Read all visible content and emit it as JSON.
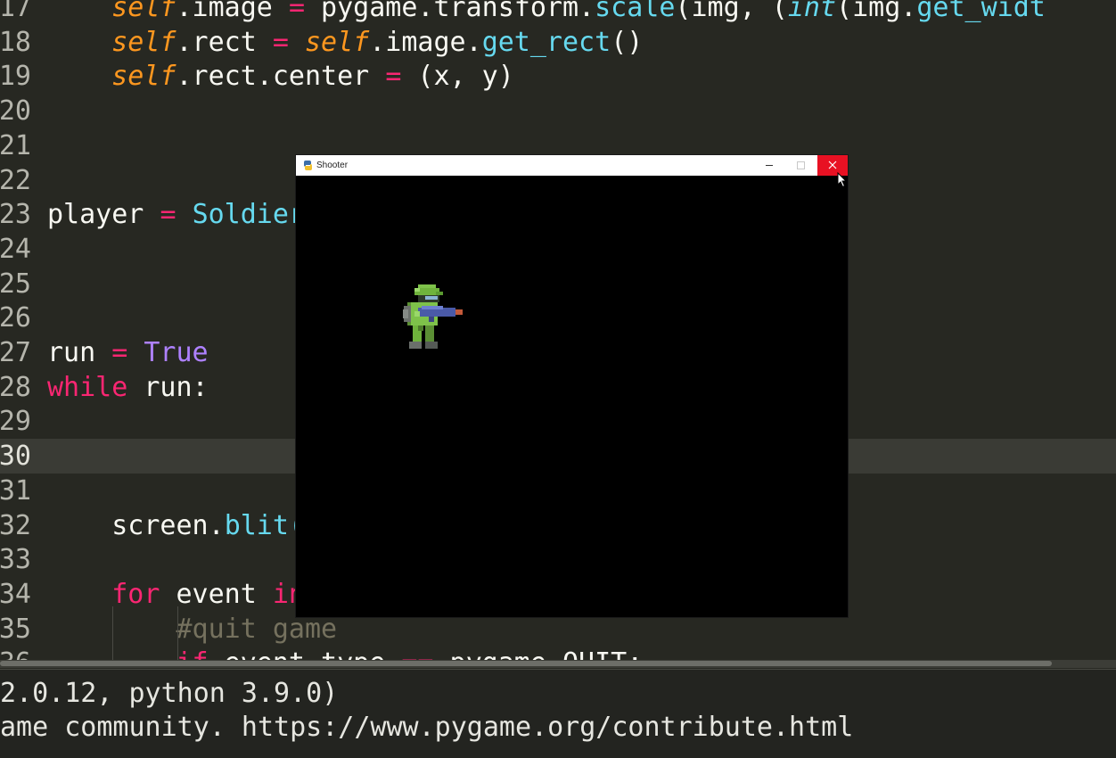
{
  "editor": {
    "lines": [
      {
        "n": "17",
        "tokens": [
          [
            "",
            "    "
          ],
          [
            "self",
            "self"
          ],
          [
            "",
            ".image "
          ],
          [
            "op",
            "="
          ],
          [
            "",
            " pygame.transform."
          ],
          [
            "fn",
            "scale"
          ],
          [
            "",
            "(img, ("
          ],
          [
            "int",
            "int"
          ],
          [
            "",
            "(img."
          ],
          [
            "fn",
            "get_widt"
          ]
        ]
      },
      {
        "n": "18",
        "tokens": [
          [
            "",
            "    "
          ],
          [
            "self",
            "self"
          ],
          [
            "",
            ".rect "
          ],
          [
            "op",
            "="
          ],
          [
            "",
            " "
          ],
          [
            "self",
            "self"
          ],
          [
            "",
            ".image."
          ],
          [
            "fn",
            "get_rect"
          ],
          [
            "",
            "()"
          ]
        ]
      },
      {
        "n": "19",
        "tokens": [
          [
            "",
            "    "
          ],
          [
            "self",
            "self"
          ],
          [
            "",
            ".rect.center "
          ],
          [
            "op",
            "="
          ],
          [
            "",
            " (x, y)"
          ]
        ]
      },
      {
        "n": "20",
        "tokens": []
      },
      {
        "n": "21",
        "tokens": []
      },
      {
        "n": "22",
        "tokens": []
      },
      {
        "n": "23",
        "tokens": [
          [
            "",
            "player "
          ],
          [
            "op",
            "="
          ],
          [
            "",
            " "
          ],
          [
            "fn",
            "Soldier"
          ]
        ]
      },
      {
        "n": "24",
        "tokens": []
      },
      {
        "n": "25",
        "tokens": []
      },
      {
        "n": "26",
        "tokens": []
      },
      {
        "n": "27",
        "tokens": [
          [
            "",
            "run "
          ],
          [
            "op",
            "="
          ],
          [
            "",
            " "
          ],
          [
            "const",
            "True"
          ]
        ]
      },
      {
        "n": "28",
        "tokens": [
          [
            "kw",
            "while"
          ],
          [
            "",
            " run:"
          ]
        ]
      },
      {
        "n": "29",
        "tokens": []
      },
      {
        "n": "30",
        "tokens": [],
        "current": true
      },
      {
        "n": "31",
        "tokens": []
      },
      {
        "n": "32",
        "tokens": [
          [
            "",
            "    screen."
          ],
          [
            "fn",
            "blit("
          ]
        ]
      },
      {
        "n": "33",
        "tokens": []
      },
      {
        "n": "34",
        "tokens": [
          [
            "",
            "    "
          ],
          [
            "kw",
            "for"
          ],
          [
            "",
            " event "
          ],
          [
            "kw",
            "in"
          ]
        ]
      },
      {
        "n": "35",
        "tokens": [
          [
            "",
            "        "
          ],
          [
            "cmt",
            "#quit game"
          ]
        ]
      },
      {
        "n": "36",
        "tokens": [
          [
            "",
            "        "
          ],
          [
            "kw",
            "if"
          ],
          [
            "",
            " event.type "
          ],
          [
            "op",
            "=="
          ],
          [
            "",
            " pygame.QUIT:"
          ]
        ]
      }
    ]
  },
  "console": {
    "lines": [
      "2.0.12, python 3.9.0)",
      "ame community. https://www.pygame.org/contribute.html"
    ]
  },
  "pygame_window": {
    "title": "Shooter",
    "minimize_icon": "minimize-icon",
    "maximize_icon": "maximize-icon",
    "close_icon": "close-icon",
    "close_color": "#e81123",
    "background": "#000000",
    "sprite": "soldier-sprite"
  },
  "theme": {
    "editor_bg": "#272822",
    "keyword": "#f92672",
    "function": "#66d9ef",
    "self": "#fd971f",
    "constant": "#ae81ff",
    "comment": "#75715e"
  }
}
